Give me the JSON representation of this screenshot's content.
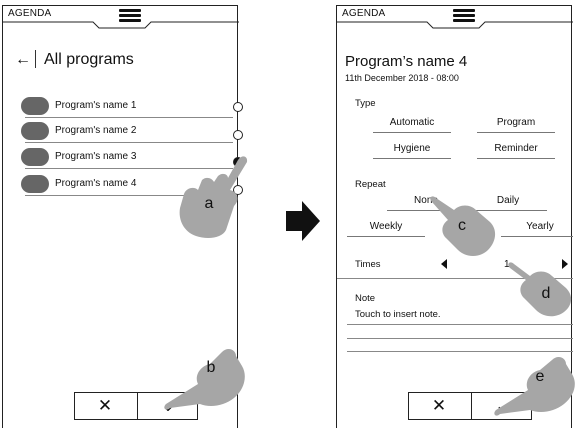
{
  "left_screen": {
    "app_label": "AGENDA",
    "title": "All programs",
    "programs": [
      {
        "name": "Program's name 1",
        "selected": false
      },
      {
        "name": "Program's name 2",
        "selected": false
      },
      {
        "name": "Program's name 3",
        "selected": true
      },
      {
        "name": "Program's name 4",
        "selected": false
      }
    ],
    "actions": {
      "close": "✕",
      "confirm": "⌄"
    }
  },
  "right_screen": {
    "app_label": "AGENDA",
    "title": "Program’s name 4",
    "date": "11th December 2018 - 08:00",
    "type": {
      "label": "Type",
      "options": [
        "Automatic",
        "Program",
        "Hygiene",
        "Reminder"
      ]
    },
    "repeat": {
      "label": "Repeat",
      "options": [
        "None",
        "Daily",
        "Weekly",
        "Yearly"
      ]
    },
    "times": {
      "label": "Times",
      "value": "1"
    },
    "note": {
      "label": "Note",
      "placeholder": "Touch to insert note."
    },
    "actions": {
      "close": "✕",
      "confirm": "⌄"
    }
  },
  "callouts": [
    "a",
    "b",
    "c",
    "d",
    "e"
  ],
  "colors": {
    "pill": "#666666",
    "hand": "#a6a6a6",
    "arrow": "#111111"
  }
}
